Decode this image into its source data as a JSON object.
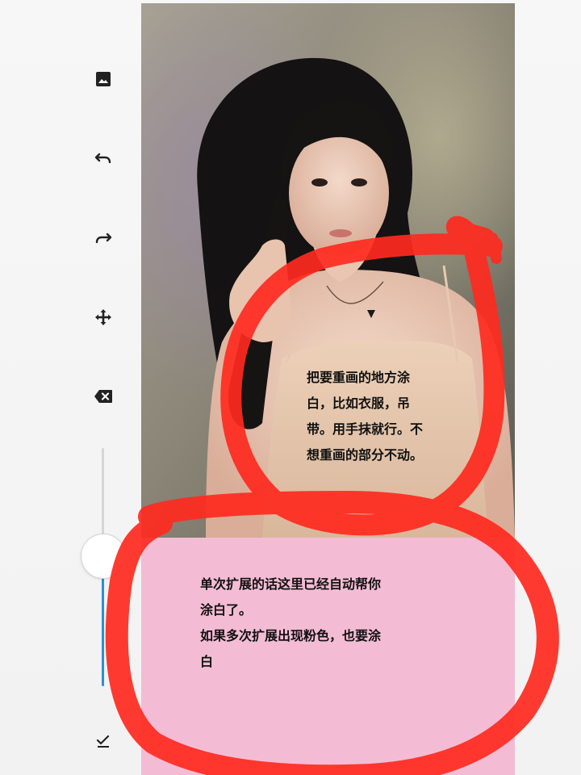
{
  "toolbar": {
    "tools": [
      {
        "id": "image",
        "icon": "image-icon"
      },
      {
        "id": "undo",
        "icon": "undo-icon"
      },
      {
        "id": "redo",
        "icon": "redo-icon"
      },
      {
        "id": "move",
        "icon": "move-icon"
      },
      {
        "id": "erase",
        "icon": "backspace-icon"
      },
      {
        "id": "confirm",
        "icon": "check-icon"
      }
    ],
    "brush_size": 0.55
  },
  "colors": {
    "slider_fill": "#2b8fd6",
    "expansion_fill": "#f3bcd4",
    "annotation": "#ff2a1f"
  },
  "canvas": {
    "photo": "portrait-photo",
    "expansion_area": "pink-fill"
  },
  "annotations": {
    "top_note": "把要重画的地方涂\n白，比如衣服，吊\n带。用手抹就行。不\n想重画的部分不动。",
    "bottom_note": "单次扩展的话这里已经自动帮你\n涂白了。\n如果多次扩展出现粉色，也要涂\n白"
  }
}
